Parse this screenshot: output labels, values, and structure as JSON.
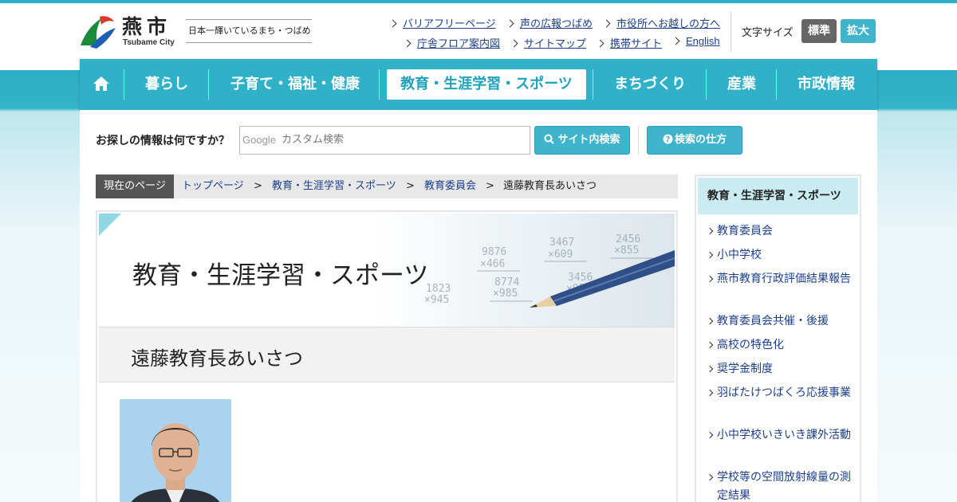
{
  "header": {
    "logo_text": "燕市",
    "logo_subtext": "Tsubame City",
    "catchphrase": "日本一輝いているまち・つばめ",
    "utility_links": [
      "バリアフリーページ",
      "声の広報つばめ",
      "市役所へお越しの方へ",
      "庁舎フロア案内図",
      "サイトマップ",
      "携帯サイト",
      "English"
    ],
    "font_size_label": "文字サイズ",
    "font_size_standard": "標準",
    "font_size_large": "拡大"
  },
  "nav": {
    "home_icon": "home-icon",
    "items": [
      "暮らし",
      "子育て・福祉・健康",
      "教育・生涯学習・スポーツ",
      "まちづくり",
      "産業",
      "市政情報"
    ],
    "active_index": 2
  },
  "search": {
    "question": "お探しの情報は何ですか？",
    "google_label": "Google",
    "placeholder": "カスタム検索",
    "search_button": "サイト内検索",
    "help_button": "検索の仕方"
  },
  "breadcrumb": {
    "label": "現在のページ",
    "items": [
      "トップページ",
      "教育・生涯学習・スポーツ",
      "教育委員会",
      "遠藤教育長あいさつ"
    ],
    "separator": ">"
  },
  "main": {
    "category_title": "教育・生涯学習・スポーツ",
    "page_title": "遠藤教育長あいさつ",
    "hero_numbers": [
      "9876",
      "×466",
      "3467",
      "×609",
      "2456",
      "×855",
      "8774",
      "×985",
      "3456",
      "×956",
      "1823",
      "×945"
    ]
  },
  "sidebar": {
    "heading": "教育・生涯学習・スポーツ",
    "items": [
      "教育委員会",
      "小中学校",
      "燕市教育行政評価結果報告",
      "教育委員会共催・後援",
      "高校の特色化",
      "奨学金制度",
      "羽ばたけつばくろ応援事業",
      "小中学校いきいき課外活動",
      "学校等の空間放射線量の測定結果"
    ]
  },
  "colors": {
    "accent": "#31b1c7",
    "link": "#1c3f8c",
    "font_standard_bg": "#666666",
    "font_large_bg": "#3fb4cb"
  }
}
